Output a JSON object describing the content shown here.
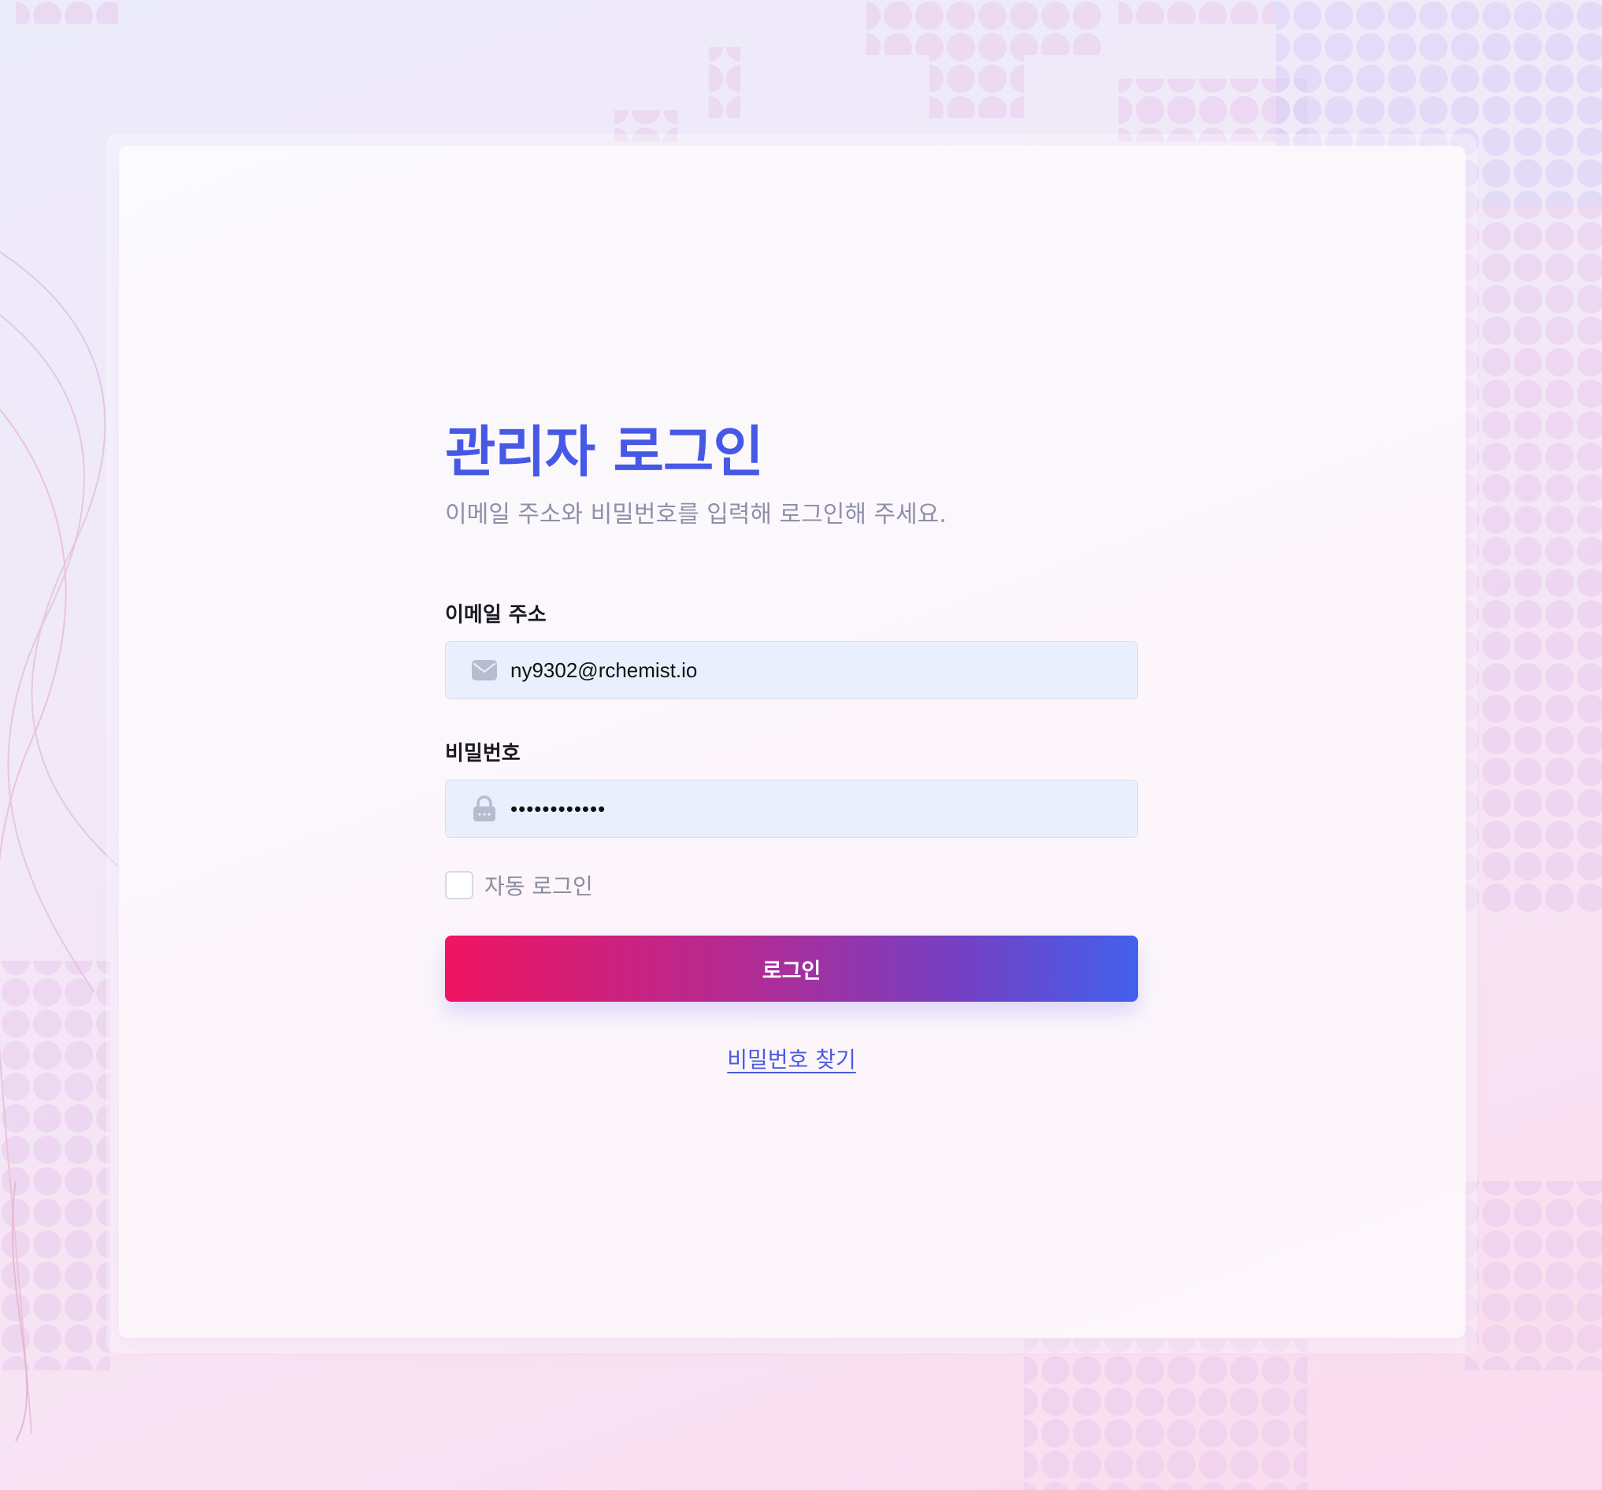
{
  "login": {
    "title": "관리자 로그인",
    "subtitle": "이메일 주소와 비밀번호를 입력해 로그인해 주세요.",
    "email_label": "이메일 주소",
    "email_value": "ny9302@rchemist.io",
    "password_label": "비밀번호",
    "password_value": "••••••••••••",
    "auto_login_label": "자동 로그인",
    "auto_login_checked": false,
    "login_button": "로그인",
    "find_password_link": "비밀번호 찾기"
  },
  "icons": {
    "email": "mail-icon",
    "password": "lock-icon"
  },
  "colors": {
    "title": "#4558e6",
    "button_start": "#ef1561",
    "button_end": "#4260ec",
    "link": "#4a5be3",
    "field_bg": "#e9effc"
  }
}
